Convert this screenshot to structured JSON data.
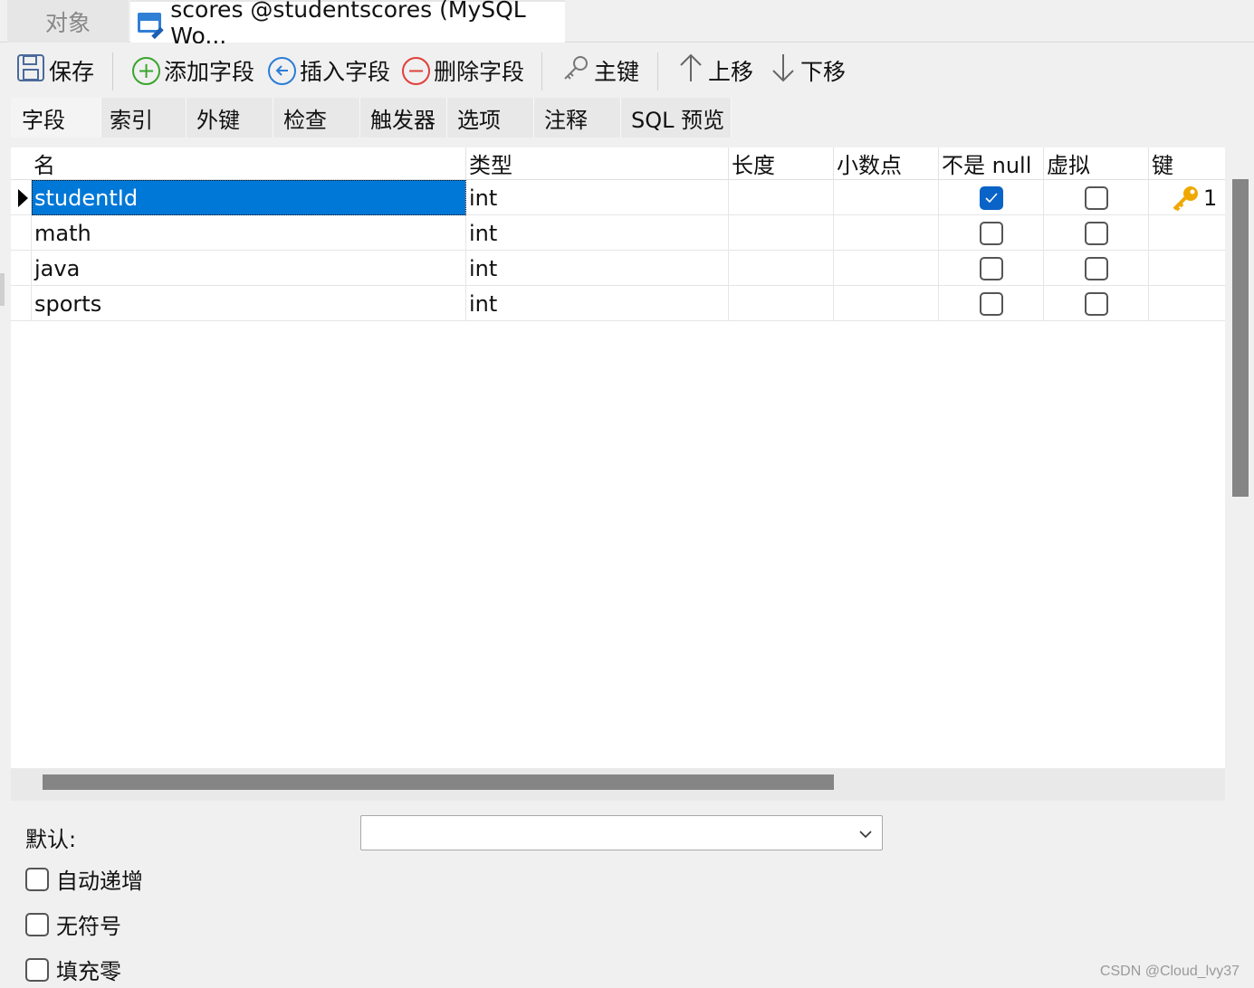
{
  "doc_tabs": {
    "objects_label": "对象",
    "active_label": "scores @studentscores (MySQL Wo..."
  },
  "toolbar": {
    "save": "保存",
    "add_field": "添加字段",
    "insert_field": "插入字段",
    "delete_field": "删除字段",
    "primary_key": "主键",
    "move_up": "上移",
    "move_down": "下移"
  },
  "sub_tabs": [
    {
      "label": "字段",
      "active": true
    },
    {
      "label": "索引"
    },
    {
      "label": "外键"
    },
    {
      "label": "检查"
    },
    {
      "label": "触发器"
    },
    {
      "label": "选项"
    },
    {
      "label": "注释"
    },
    {
      "label": "SQL 预览"
    }
  ],
  "grid": {
    "columns": [
      "名",
      "类型",
      "长度",
      "小数点",
      "不是 null",
      "虚拟",
      "键"
    ],
    "rows": [
      {
        "name": "studentId",
        "type": "int",
        "length": "",
        "decimals": "",
        "not_null": true,
        "virtual": false,
        "key": "1",
        "selected": true
      },
      {
        "name": "math",
        "type": "int",
        "length": "",
        "decimals": "",
        "not_null": false,
        "virtual": false,
        "key": ""
      },
      {
        "name": "java",
        "type": "int",
        "length": "",
        "decimals": "",
        "not_null": false,
        "virtual": false,
        "key": ""
      },
      {
        "name": "sports",
        "type": "int",
        "length": "",
        "decimals": "",
        "not_null": false,
        "virtual": false,
        "key": ""
      }
    ]
  },
  "properties": {
    "default_label": "默认:",
    "default_value": "",
    "auto_increment": "自动递增",
    "unsigned": "无符号",
    "zerofill": "填充零"
  },
  "watermark": "CSDN @Cloud_lvy37",
  "colors": {
    "selection": "#0078d7",
    "key_icon": "#f0a800"
  }
}
